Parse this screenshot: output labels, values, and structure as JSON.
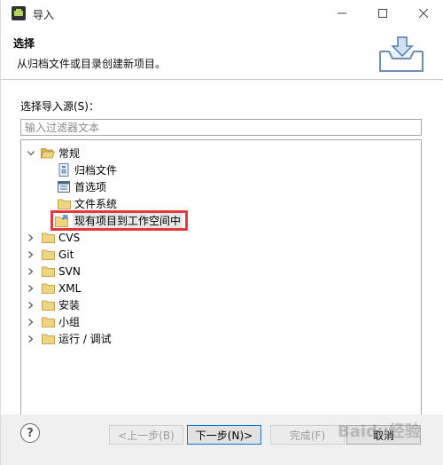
{
  "window": {
    "title": "导入",
    "controls": {
      "minimize_icon": "minimize-icon",
      "maximize_icon": "maximize-icon",
      "close_icon": "close-icon"
    }
  },
  "banner": {
    "title": "选择",
    "description": "从归档文件或目录创建新项目。",
    "image_icon": "import-wizard-icon"
  },
  "source": {
    "label": "选择导入源(S)：",
    "filter_placeholder": "输入过滤器文本"
  },
  "tree": {
    "items": [
      {
        "label": "常规",
        "expanded": true,
        "icon": "folder-open-icon"
      },
      {
        "label": "归档文件",
        "icon": "archive-file-icon"
      },
      {
        "label": "首选项",
        "icon": "preferences-icon"
      },
      {
        "label": "文件系统",
        "icon": "folder-icon"
      },
      {
        "label": "现有项目到工作空间中",
        "icon": "existing-project-icon",
        "selected": true,
        "highlight_color": "#e1393c"
      },
      {
        "label": "CVS",
        "icon": "folder-icon"
      },
      {
        "label": "Git",
        "icon": "folder-icon"
      },
      {
        "label": "SVN",
        "icon": "folder-icon"
      },
      {
        "label": "XML",
        "icon": "folder-icon"
      },
      {
        "label": "安装",
        "icon": "folder-icon"
      },
      {
        "label": "小组",
        "icon": "folder-icon"
      },
      {
        "label": "运行 / 调试",
        "icon": "folder-icon"
      }
    ]
  },
  "footer": {
    "help_label": "?",
    "back_label": "<上一步(B)",
    "next_label": "下一步(N)>",
    "finish_label": "完成(F)",
    "cancel_label": "取消"
  },
  "watermark": "Baidu经验",
  "colors": {
    "folder": "#e8c46a",
    "highlight": "#e1393c",
    "default_button_border": "#0078d7"
  }
}
